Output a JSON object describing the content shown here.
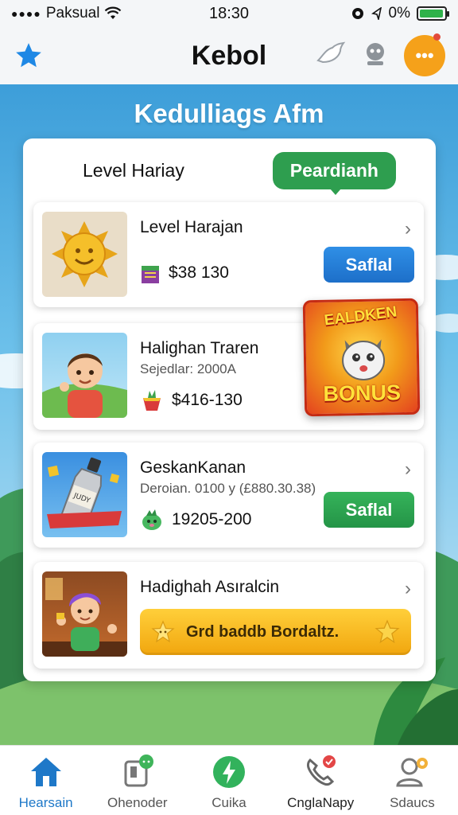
{
  "status_bar": {
    "carrier": "Paksual",
    "time": "18:30",
    "battery": "0%",
    "battery_level": 0.95
  },
  "header": {
    "title": "Kebol"
  },
  "banner": {
    "title": "Kedulliags Afm"
  },
  "panel": {
    "title": "Level Hariay",
    "pill_label": "Peardianh"
  },
  "cards": [
    {
      "title": "Level Harajan",
      "price": "$38 130",
      "button": "Saflal",
      "button_color": "#1d6fc9"
    },
    {
      "title": "Halighan Traren",
      "subtitle": "Sejedlar: 2000A",
      "price": "$416-130"
    },
    {
      "title": "GeskanKanan",
      "subtitle": "Deroian. 0100 y (£880.30.38)",
      "price": "19205-200",
      "button": "Saflal",
      "button_color": "#249447",
      "thumb_label": "JUDY"
    },
    {
      "title": "Hadighah Asıralcin",
      "promo": "Grd baddb Bordaltz."
    }
  ],
  "bonus": {
    "top_text": "EALDKEN",
    "bottom_text": "BONUS"
  },
  "nav": [
    {
      "label": "Hearsain",
      "icon": "home-icon",
      "active": true
    },
    {
      "label": "Ohenoder",
      "icon": "document-icon",
      "active": false
    },
    {
      "label": "Cuika",
      "icon": "lightning-icon",
      "active": false
    },
    {
      "label": "CnglaNapy",
      "icon": "phone-icon",
      "active": false
    },
    {
      "label": "Sdaucs",
      "icon": "user-icon",
      "active": false
    }
  ],
  "colors": {
    "accent_blue": "#1e78c8",
    "accent_green": "#2e9e4f",
    "accent_orange": "#f5a11a"
  }
}
